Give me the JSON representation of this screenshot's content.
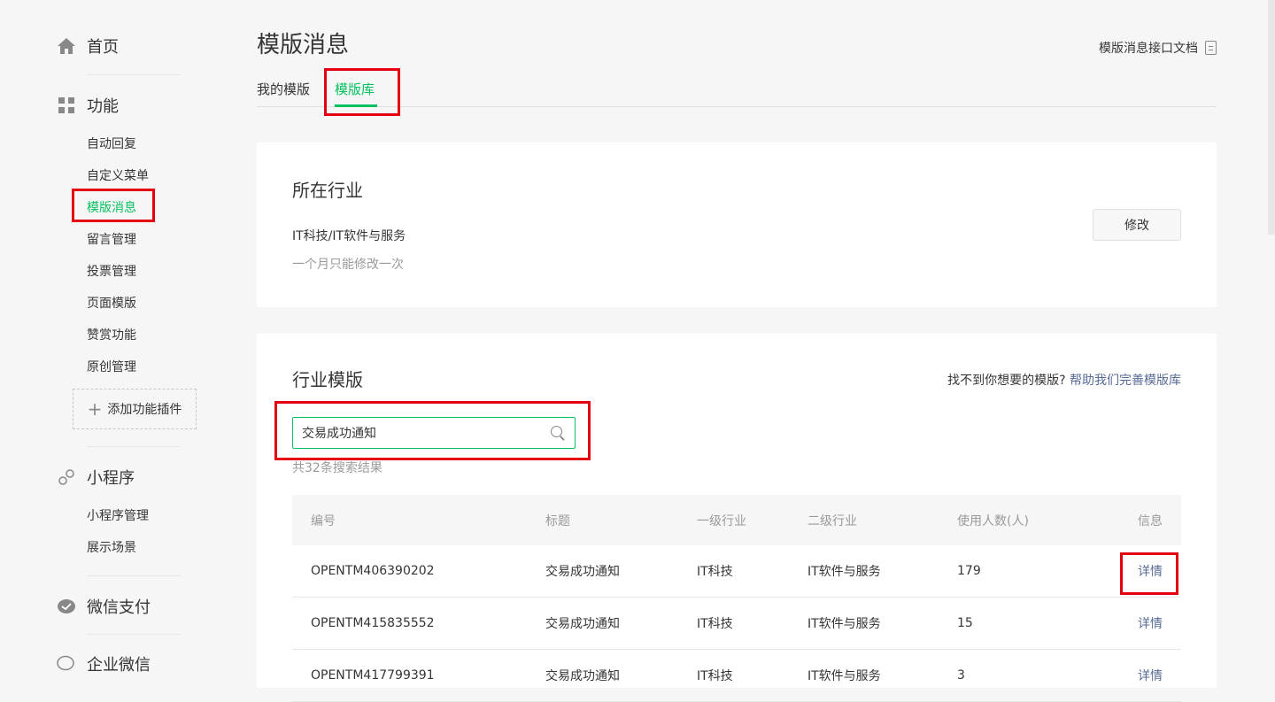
{
  "sidebar": {
    "home": "首页",
    "features": {
      "title": "功能",
      "items": [
        "自动回复",
        "自定义菜单",
        "模版消息",
        "留言管理",
        "投票管理",
        "页面模版",
        "赞赏功能",
        "原创管理"
      ],
      "add_plugin": "添加功能插件"
    },
    "miniprogram": {
      "title": "小程序",
      "items": [
        "小程序管理",
        "展示场景"
      ]
    },
    "wechat_pay": "微信支付",
    "wecom": "企业微信"
  },
  "header": {
    "title": "模版消息",
    "doc_link": "模版消息接口文档",
    "tabs": [
      "我的模版",
      "模版库"
    ]
  },
  "industry_card": {
    "title": "所在行业",
    "industry": "IT科技/IT软件与服务",
    "hint": "一个月只能修改一次",
    "modify_button": "修改"
  },
  "templates_card": {
    "title": "行业模版",
    "help_prefix": "找不到你想要的模版?",
    "help_link": "帮助我们完善模版库",
    "search_value": "交易成功通知",
    "result_count": "共32条搜索结果",
    "columns": [
      "编号",
      "标题",
      "一级行业",
      "二级行业",
      "使用人数(人)",
      "信息"
    ],
    "rows": [
      {
        "id": "OPENTM406390202",
        "title": "交易成功通知",
        "level1": "IT科技",
        "level2": "IT软件与服务",
        "users": "179",
        "info": "详情"
      },
      {
        "id": "OPENTM415835552",
        "title": "交易成功通知",
        "level1": "IT科技",
        "level2": "IT软件与服务",
        "users": "15",
        "info": "详情"
      },
      {
        "id": "OPENTM417799391",
        "title": "交易成功通知",
        "level1": "IT科技",
        "level2": "IT软件与服务",
        "users": "3",
        "info": "详情"
      }
    ]
  },
  "colors": {
    "accent": "#07c160",
    "link": "#576b95",
    "highlight": "#e30010"
  }
}
